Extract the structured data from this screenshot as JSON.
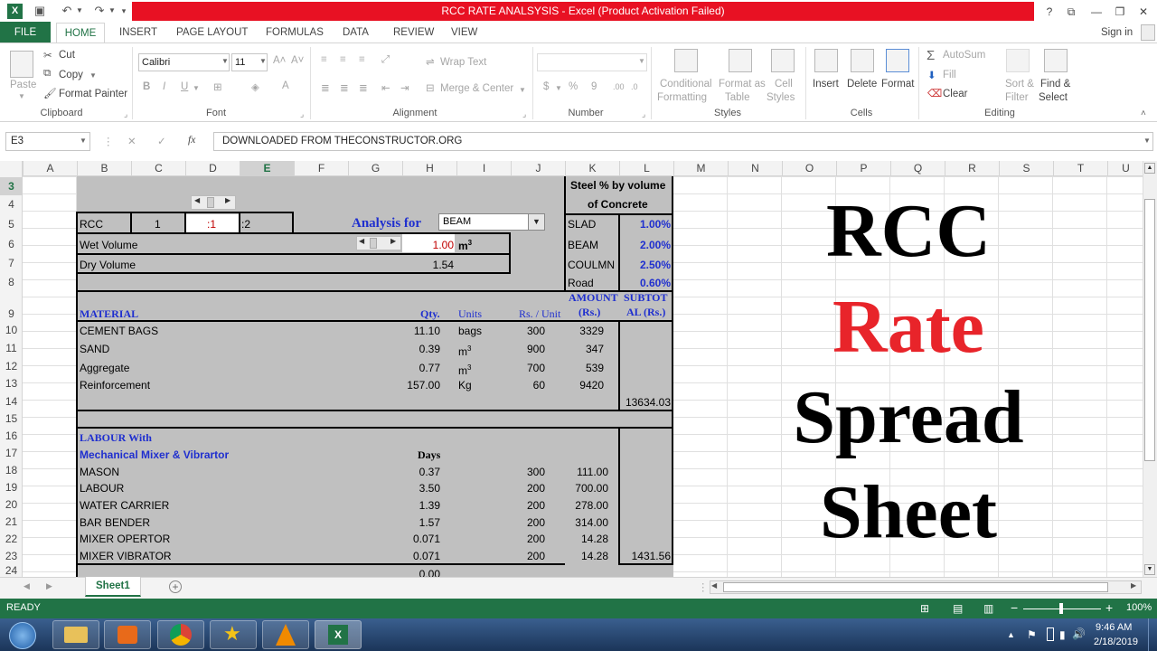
{
  "window": {
    "title": "RCC RATE ANALSYSIS  -  Excel (Product Activation Failed)",
    "help": "?",
    "signin": "Sign in"
  },
  "tabs": [
    "FILE",
    "HOME",
    "INSERT",
    "PAGE LAYOUT",
    "FORMULAS",
    "DATA",
    "REVIEW",
    "VIEW"
  ],
  "ribbon": {
    "clipboard": {
      "paste": "Paste",
      "cut": "Cut",
      "copy": "Copy",
      "painter": "Format Painter",
      "label": "Clipboard"
    },
    "font": {
      "name": "Calibri",
      "size": "11",
      "label": "Font",
      "bold": "B",
      "italic": "I",
      "underline": "U"
    },
    "alignment": {
      "wrap": "Wrap Text",
      "merge": "Merge & Center",
      "label": "Alignment"
    },
    "number": {
      "currency": "$",
      "percent": "%",
      "comma": "9",
      "label": "Number"
    },
    "styles": {
      "cond1": "Conditional",
      "cond2": "Formatting",
      "table1": "Format as",
      "table2": "Table",
      "cell1": "Cell",
      "cell2": "Styles",
      "label": "Styles"
    },
    "cells": {
      "insert": "Insert",
      "delete": "Delete",
      "format": "Format",
      "label": "Cells"
    },
    "editing": {
      "autosum": "AutoSum",
      "fill": "Fill",
      "clear": "Clear",
      "sort1": "Sort &",
      "sort2": "Filter",
      "find1": "Find &",
      "find2": "Select",
      "label": "Editing"
    }
  },
  "formula_bar": {
    "name_box": "E3",
    "content": "DOWNLOADED FROM THECONSTRUCTOR.ORG",
    "fx": "fx"
  },
  "columns": [
    "A",
    "B",
    "C",
    "D",
    "E",
    "F",
    "G",
    "H",
    "I",
    "J",
    "K",
    "L",
    "M",
    "N",
    "O",
    "P",
    "Q",
    "R",
    "S",
    "T",
    "U"
  ],
  "rows": [
    "3",
    "4",
    "5",
    "6",
    "7",
    "8",
    "9",
    "10",
    "11",
    "12",
    "13",
    "14",
    "15",
    "16",
    "17",
    "18",
    "19",
    "20",
    "21",
    "22",
    "23",
    "24"
  ],
  "sheet": {
    "rcc_label": "RCC",
    "ratio_1": "1",
    "ratio_2": ":1",
    "ratio_3": ":2",
    "analysis_for": "Analysis for",
    "element_select": "BEAM",
    "wet_volume_label": "Wet Volume",
    "wet_volume": "1.00",
    "unit_m3": "m",
    "dry_volume_label": "Dry Volume",
    "dry_volume": "1.54",
    "steel_header_1": "Steel % by volume",
    "steel_header_2": "of Concrete",
    "steel": [
      {
        "name": "SLAD",
        "pct": "1.00%"
      },
      {
        "name": "BEAM",
        "pct": "2.00%"
      },
      {
        "name": "COULMN",
        "pct": "2.50%"
      },
      {
        "name": "Road",
        "pct": "0.60%"
      }
    ],
    "hdr_material": "MATERIAL",
    "hdr_qty": "Qty.",
    "hdr_units": "Units",
    "hdr_rate": "Rs. / Unit",
    "hdr_amount_1": "AMOUNT",
    "hdr_amount_2": "(Rs.)",
    "hdr_subtotal_1": "SUBTOT",
    "hdr_subtotal_2": "AL (Rs.)",
    "materials": [
      {
        "name": "CEMENT BAGS",
        "qty": "11.10",
        "unit": "bags",
        "rate": "300",
        "amount": "3329"
      },
      {
        "name": "SAND",
        "qty": "0.39",
        "unit": "m",
        "rate": "900",
        "amount": "347"
      },
      {
        "name": "Aggregate",
        "qty": "0.77",
        "unit": "m",
        "rate": "700",
        "amount": "539"
      },
      {
        "name": "Reinforcement",
        "qty": "157.00",
        "unit": "Kg",
        "rate": "60",
        "amount": "9420"
      }
    ],
    "material_subtotal": "13634.03",
    "labour_hdr_1": "LABOUR With",
    "labour_hdr_2": "Mechanical Mixer & Vibrartor",
    "days_hdr": "Days",
    "labour": [
      {
        "name": "MASON",
        "days": "0.37",
        "rate": "300",
        "amount": "111.00"
      },
      {
        "name": "LABOUR",
        "days": "3.50",
        "rate": "200",
        "amount": "700.00"
      },
      {
        "name": "WATER CARRIER",
        "days": "1.39",
        "rate": "200",
        "amount": "278.00"
      },
      {
        "name": "BAR BENDER",
        "days": "1.57",
        "rate": "200",
        "amount": "314.00"
      },
      {
        "name": "MIXER OPERTOR",
        "days": "0.071",
        "rate": "200",
        "amount": "14.28"
      },
      {
        "name": "MIXER VIBRATOR",
        "days": "0.071",
        "rate": "200",
        "amount": "14.28"
      }
    ],
    "labour_subtotal": "1431.56",
    "row24_value": "0.00",
    "title_lines": [
      "RCC",
      "Rate",
      "Spread",
      "Sheet"
    ]
  },
  "sheet_tab": "Sheet1",
  "status": {
    "ready": "READY",
    "zoom": "100%"
  },
  "taskbar": {
    "time": "9:46 AM",
    "date": "2/18/2019"
  },
  "colors": {
    "excel_green": "#217346",
    "title_red": "#e81123",
    "rate_red": "#e8242a",
    "grey_fill": "#c0c0c0",
    "label_blue": "#1f2fcf"
  }
}
